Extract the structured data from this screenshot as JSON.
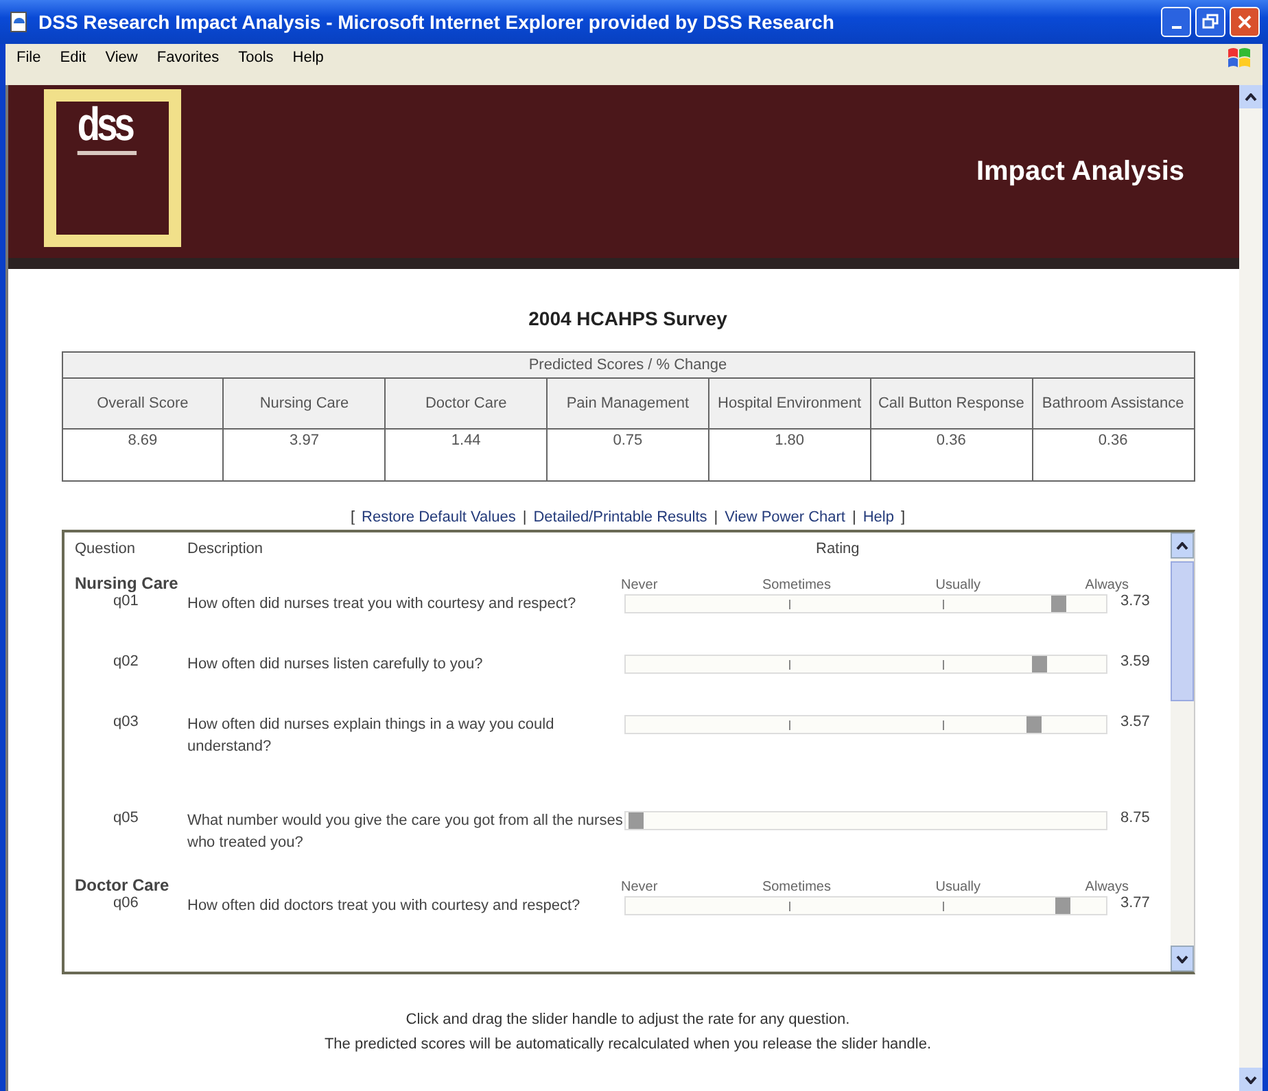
{
  "window": {
    "title": "DSS Research Impact Analysis - Microsoft Internet Explorer provided by DSS Research"
  },
  "menu": [
    "File",
    "Edit",
    "View",
    "Favorites",
    "Tools",
    "Help"
  ],
  "header": {
    "logo": "dss",
    "title": "Impact Analysis"
  },
  "survey_title": "2004 HCAHPS Survey",
  "scores": {
    "caption": "Predicted Scores / % Change",
    "columns": [
      "Overall Score",
      "Nursing Care",
      "Doctor Care",
      "Pain Management",
      "Hospital Environment",
      "Call Button Response",
      "Bathroom Assistance"
    ],
    "values": [
      "8.69",
      "3.97",
      "1.44",
      "0.75",
      "1.80",
      "0.36",
      "0.36"
    ]
  },
  "links": {
    "open": "[",
    "close": "]",
    "separator": "|",
    "items": [
      "Restore Default Values",
      "Detailed/Printable Results",
      "View Power Chart",
      "Help"
    ]
  },
  "panel": {
    "columns": {
      "question": "Question",
      "description": "Description",
      "rating": "Rating"
    },
    "sections": [
      {
        "name": "Nursing Care",
        "scale_labels": [
          "Never",
          "Sometimes",
          "Usually",
          "Always"
        ],
        "questions": [
          {
            "id": "q01",
            "text": "How often did nurses treat you with courtesy and respect?",
            "kind": "scale",
            "level": 0.9,
            "reading": "3.73"
          },
          {
            "id": "q02",
            "text": "How often did nurses listen carefully to you?",
            "kind": "scale",
            "level": 0.86,
            "reading": "3.59"
          },
          {
            "id": "q03",
            "text": "How often did nurses explain things in a way you could understand?",
            "kind": "scale",
            "level": 0.85,
            "reading": "3.57"
          },
          {
            "id": "q05",
            "text": "What number would you give the care you got from all the nurses who treated you?",
            "kind": "rating",
            "level": 0.02,
            "reading": "8.75"
          }
        ]
      },
      {
        "name": "Doctor Care",
        "scale_labels": [
          "Never",
          "Sometimes",
          "Usually",
          "Always"
        ],
        "questions": [
          {
            "id": "q06",
            "text": "How often did doctors treat you with courtesy and respect?",
            "kind": "scale",
            "level": 0.91,
            "reading": "3.77"
          }
        ]
      }
    ]
  },
  "footer": [
    "Click and drag the slider handle to adjust the rate for any question.",
    "The predicted scores will be automatically recalculated when you release the slider handle."
  ]
}
